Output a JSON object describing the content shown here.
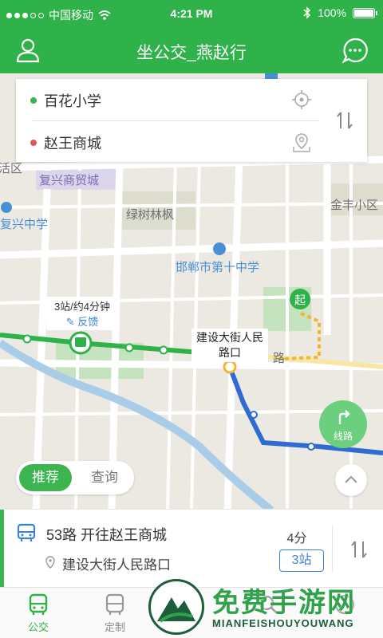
{
  "status_bar": {
    "carrier": "中国移动",
    "time": "4:21 PM",
    "battery": "100%",
    "signal_icon": "signal-dots-icon",
    "wifi_icon": "wifi-icon",
    "bluetooth_icon": "bluetooth-icon"
  },
  "header": {
    "title": "坐公交_燕赵行",
    "left_icon": "user-icon",
    "right_icon": "chat-icon"
  },
  "search": {
    "origin": "百花小学",
    "destination": "赵王商城",
    "origin_dot_color": "#3cb44f",
    "destination_dot_color": "#e0584f"
  },
  "map": {
    "labels": {
      "district1": "复兴商贸城",
      "district_left": "区",
      "area_left_top": "活区",
      "school_left": "复兴中学",
      "park": "绿树林枫",
      "community": "金丰小区",
      "school_main": "邯郸市第十中学",
      "road": "路"
    },
    "travel_info": "3站/约4分钟",
    "feedback": "反馈",
    "stop_name": "建设大街人民路口",
    "start_marker": "起"
  },
  "controls": {
    "route_button": "线路",
    "toggle_recommend": "推荐",
    "toggle_query": "查询"
  },
  "result": {
    "route": "53路 开往赵王商城",
    "stop": "建设大街人民路口",
    "minutes": "4分",
    "stations": "3站"
  },
  "tabs": [
    {
      "label": "公交",
      "icon": "bus-front-icon",
      "active": true
    },
    {
      "label": "定制",
      "icon": "bus-custom-icon",
      "active": false
    },
    {
      "label": "",
      "icon": "car-icon",
      "active": false
    },
    {
      "label": "",
      "icon": "search-icon",
      "active": false
    },
    {
      "label": "",
      "icon": "profile-icon",
      "active": false
    }
  ],
  "watermark": {
    "title": "免费手游网",
    "subtitle": "MIANFEISHOUYOUWANG"
  },
  "colors": {
    "brand_green": "#2fb24a",
    "accent_blue": "#3a83d5"
  }
}
